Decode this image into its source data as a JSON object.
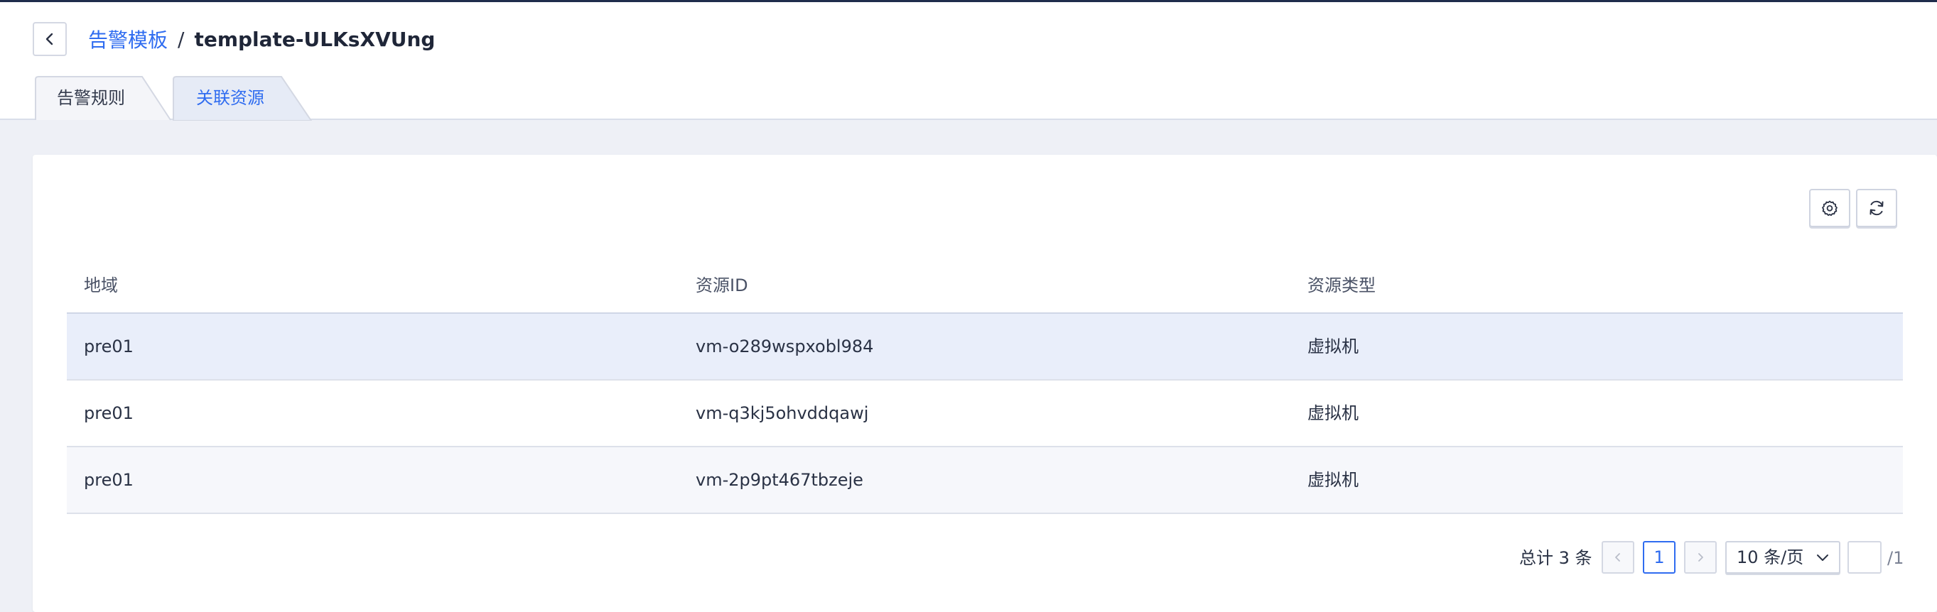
{
  "breadcrumb": {
    "parent": "告警模板",
    "separator": "/",
    "current": "template-ULKsXVUng"
  },
  "tabs": [
    {
      "label": "告警规则",
      "active": false
    },
    {
      "label": "关联资源",
      "active": true
    }
  ],
  "toolbar": {
    "settings_icon": "gear-icon",
    "refresh_icon": "refresh-icon"
  },
  "table": {
    "columns": [
      "地域",
      "资源ID",
      "资源类型"
    ],
    "rows": [
      {
        "region": "pre01",
        "resource_id": "vm-o289wspxobl984",
        "type": "虚拟机"
      },
      {
        "region": "pre01",
        "resource_id": "vm-q3kj5ohvddqawj",
        "type": "虚拟机"
      },
      {
        "region": "pre01",
        "resource_id": "vm-2p9pt467tbzeje",
        "type": "虚拟机"
      }
    ]
  },
  "pagination": {
    "total_text": "总计 3 条",
    "current_page": "1",
    "page_size": "10 条/页",
    "jump_value": "",
    "total_pages": "/1"
  },
  "colors": {
    "accent": "#2f6cf0",
    "header_bar": "#1f2d4c",
    "row_highlight": "#e9eefa",
    "page_bg": "#eef0f6"
  }
}
